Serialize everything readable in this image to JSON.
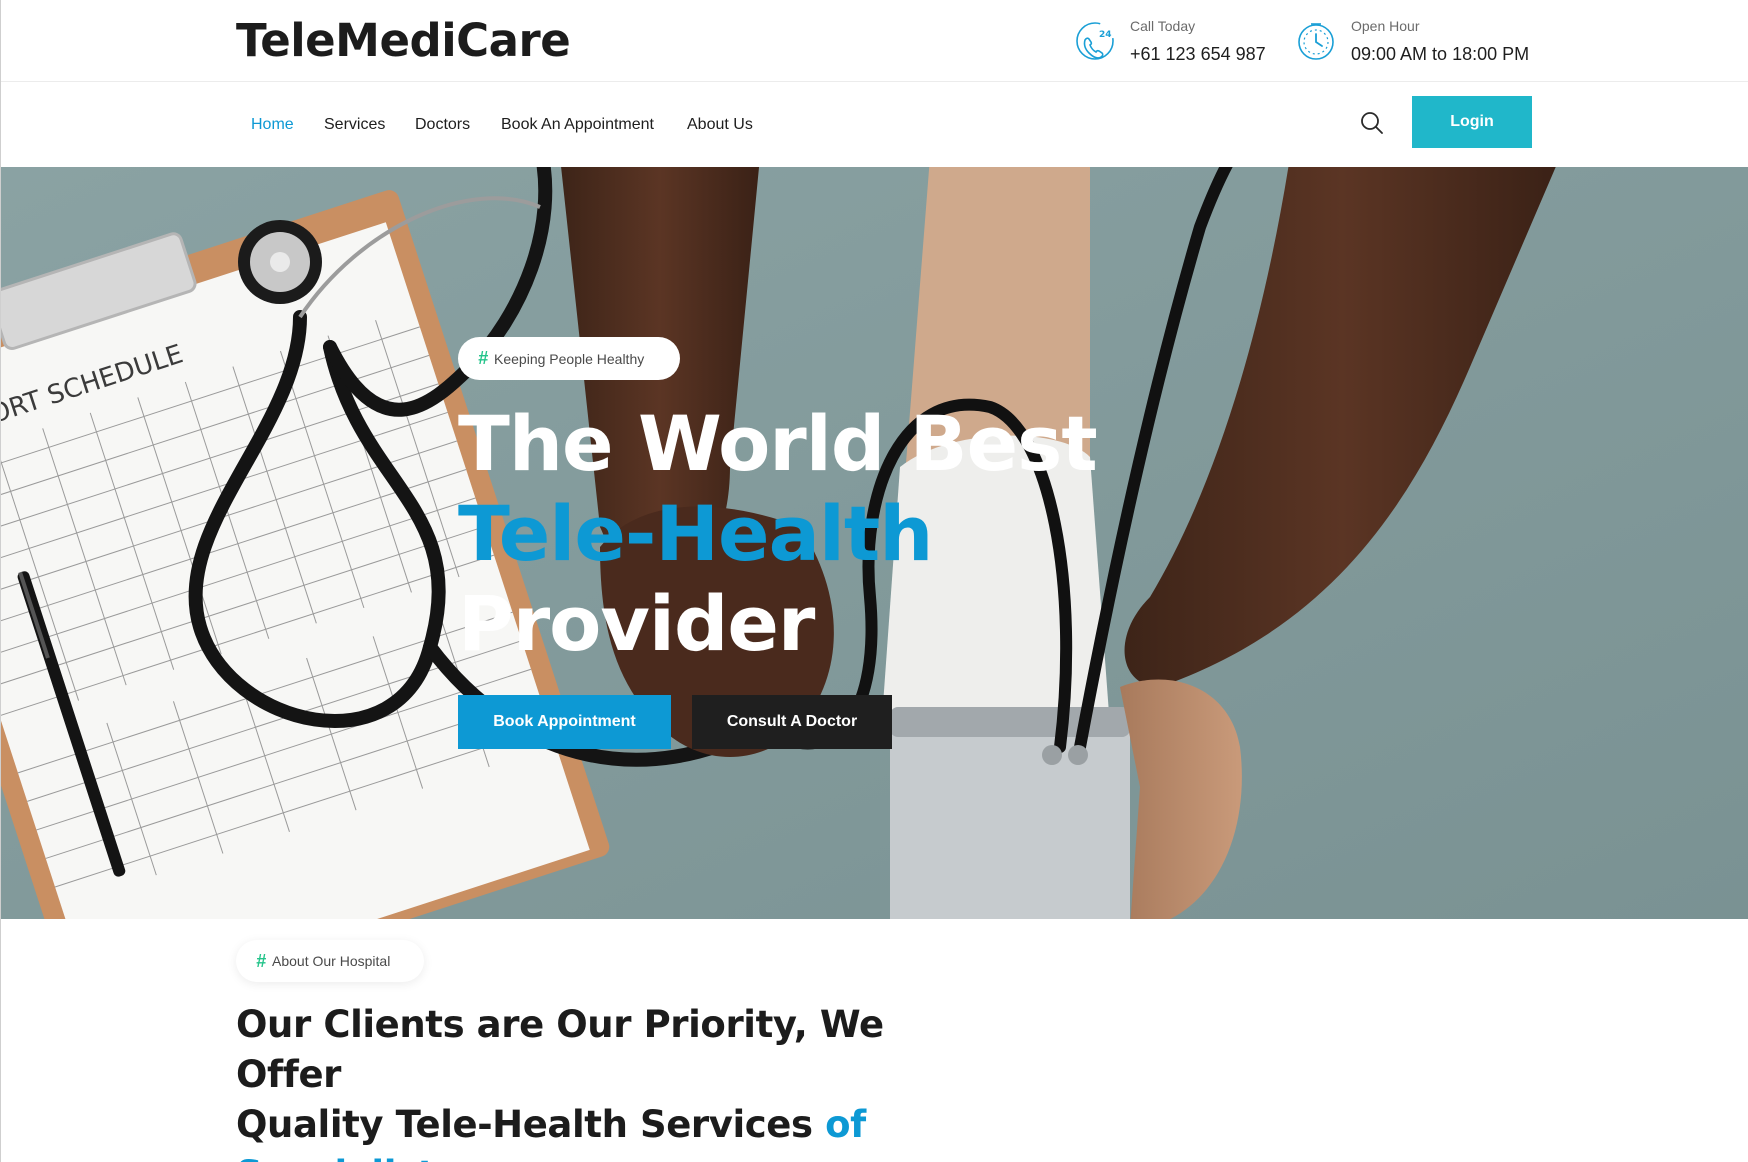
{
  "brand": {
    "name": "TeleMediCare"
  },
  "contact": {
    "call": {
      "label": "Call Today",
      "value": "+61 123 654 987",
      "icon": "phone-24-icon"
    },
    "hours": {
      "label": "Open Hour",
      "value": "09:00 AM to 18:00 PM",
      "icon": "clock-icon"
    }
  },
  "nav": {
    "items": [
      {
        "label": "Home",
        "active": true
      },
      {
        "label": "Services"
      },
      {
        "label": "Doctors"
      },
      {
        "label": "Book An Appointment"
      },
      {
        "label": "About Us"
      }
    ],
    "search_icon": "search-icon",
    "login_label": "Login"
  },
  "hero": {
    "tag": "Keeping People Healthy",
    "title_line1": "The World Best",
    "title_line2": "Tele-Health",
    "title_line3": "Provider",
    "book_label": "Book Appointment",
    "consult_label": "Consult A Doctor",
    "image_paper_text": "Y REPORT SCHEDULE"
  },
  "about": {
    "tag": "About Our Hospital",
    "heading_line1": "Our Clients are Our Priority, We Offer",
    "heading_line2": "Quality Tele-Health Services ",
    "heading_line2_accent": "of",
    "heading_line3": "Specialists"
  },
  "colors": {
    "accent_blue": "#0d99d4",
    "login_teal": "#20b7ca",
    "dark_button": "#1f1f1f",
    "hash_green": "#25c48b"
  }
}
